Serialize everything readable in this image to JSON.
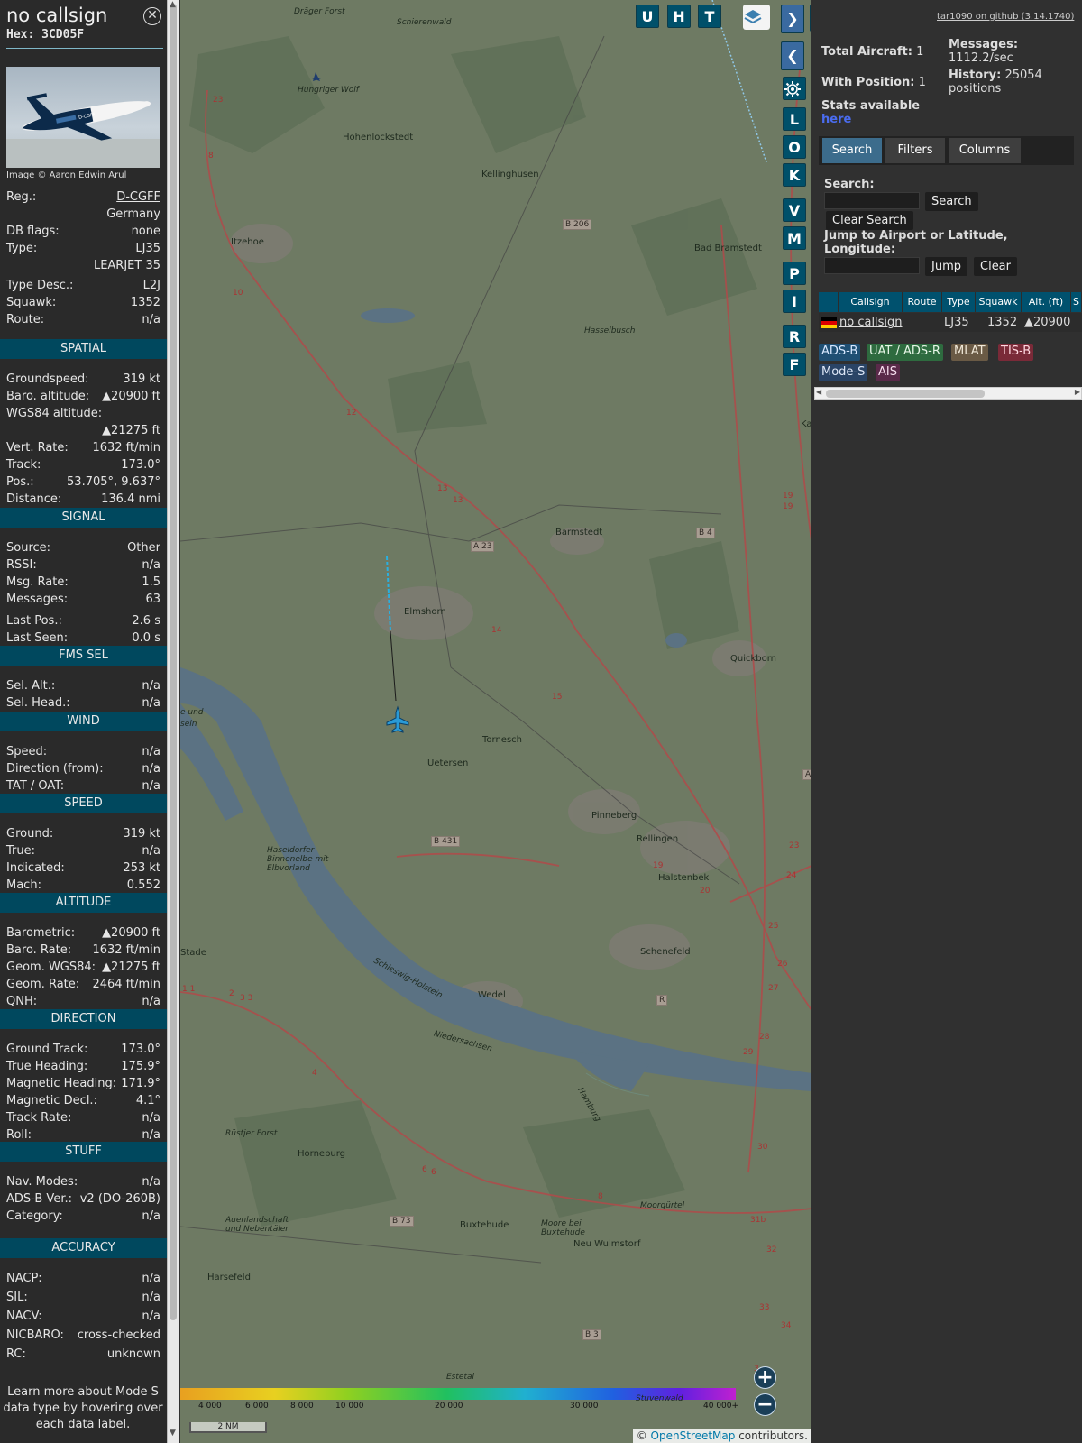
{
  "aircraft": {
    "callsign": "no callsign",
    "hex_label": "Hex:",
    "hex": "3CD05F",
    "image_credit": "Image © Aaron Edwin Arul",
    "photo_livery": "D-CGFF",
    "reg_label": "Reg.:",
    "reg": "D-CGFF",
    "country": "Germany",
    "db_flags_label": "DB flags:",
    "db_flags": "none",
    "type_label": "Type:",
    "type": "LJ35",
    "type_full": "LEARJET 35",
    "type_desc_label": "Type Desc.:",
    "type_desc": "L2J",
    "squawk_label": "Squawk:",
    "squawk": "1352",
    "route_label": "Route:",
    "route": "n/a"
  },
  "sections": [
    {
      "title": "SPATIAL",
      "rows": [
        {
          "k": "Groundspeed:",
          "v": "319 kt"
        },
        {
          "k": "Baro. altitude:",
          "v": "▲20900 ft"
        },
        {
          "k": "WGS84 altitude:",
          "v": ""
        },
        {
          "k": "",
          "v": "▲21275 ft"
        },
        {
          "k": "Vert. Rate:",
          "v": "1632 ft/min"
        },
        {
          "k": "Track:",
          "v": "173.0°"
        },
        {
          "k": "Pos.:",
          "v": "53.705°, 9.637°"
        },
        {
          "k": "Distance:",
          "v": "136.4 nmi"
        }
      ]
    },
    {
      "title": "SIGNAL",
      "rows": [
        {
          "k": "Source:",
          "v": "Other"
        },
        {
          "k": "RSSI:",
          "v": "n/a"
        },
        {
          "k": "Msg. Rate:",
          "v": "1.5"
        },
        {
          "k": "Messages:",
          "v": "63"
        },
        {
          "k": "Last Pos.:",
          "v": "2.6 s"
        },
        {
          "k": "Last Seen:",
          "v": "0.0 s"
        }
      ]
    },
    {
      "title": "FMS SEL",
      "rows": [
        {
          "k": "Sel. Alt.:",
          "v": "n/a"
        },
        {
          "k": "Sel. Head.:",
          "v": "n/a"
        }
      ]
    },
    {
      "title": "WIND",
      "rows": [
        {
          "k": "Speed:",
          "v": "n/a"
        },
        {
          "k": "Direction (from):",
          "v": "n/a"
        },
        {
          "k": "TAT / OAT:",
          "v": "n/a"
        }
      ]
    },
    {
      "title": "SPEED",
      "rows": [
        {
          "k": "Ground:",
          "v": "319 kt"
        },
        {
          "k": "True:",
          "v": "n/a"
        },
        {
          "k": "Indicated:",
          "v": "253 kt"
        },
        {
          "k": "Mach:",
          "v": "0.552"
        }
      ]
    },
    {
      "title": "ALTITUDE",
      "rows": [
        {
          "k": "Barometric:",
          "v": "▲20900 ft"
        },
        {
          "k": "Baro. Rate:",
          "v": "1632 ft/min"
        },
        {
          "k": "Geom. WGS84:",
          "v": "▲21275 ft"
        },
        {
          "k": "Geom. Rate:",
          "v": "2464 ft/min"
        },
        {
          "k": "QNH:",
          "v": "n/a"
        }
      ]
    },
    {
      "title": "DIRECTION",
      "rows": [
        {
          "k": "Ground Track:",
          "v": "173.0°"
        },
        {
          "k": "True Heading:",
          "v": "175.9°"
        },
        {
          "k": "Magnetic Heading:",
          "v": "171.9°"
        },
        {
          "k": "Magnetic Decl.:",
          "v": "4.1°"
        },
        {
          "k": "Track Rate:",
          "v": "n/a"
        },
        {
          "k": "Roll:",
          "v": "n/a"
        }
      ]
    },
    {
      "title": "STUFF",
      "rows": [
        {
          "k": "Nav. Modes:",
          "v": "n/a"
        },
        {
          "k": "ADS-B Ver.:",
          "v": "v2 (DO-260B)"
        },
        {
          "k": "Category:",
          "v": "n/a"
        }
      ]
    },
    {
      "title": "ACCURACY",
      "rows": [
        {
          "k": "NACP:",
          "v": "n/a"
        },
        {
          "k": "SIL:",
          "v": "n/a"
        },
        {
          "k": "NACV:",
          "v": "n/a"
        },
        {
          "k": "NICBARO:",
          "v": "cross-checked"
        },
        {
          "k": "RC:",
          "v": "unknown"
        }
      ]
    }
  ],
  "footer_note": "Learn more about Mode S data type by hovering over each data label.",
  "map": {
    "top_buttons": [
      "U",
      "H",
      "T"
    ],
    "layers_icon": "layers-icon",
    "side_buttons": [
      "L",
      "O",
      "K",
      "V",
      "M",
      "P",
      "I",
      "R",
      "F"
    ],
    "settings_icon": "gear-icon",
    "places": [
      "Dräger Forst",
      "Schierenwald",
      "Hungriger Wolf",
      "Hohenlockstedt",
      "Kellinghusen",
      "Itzehoe",
      "Bad Bramstedt",
      "Hasselbusch",
      "Barmstedt",
      "Elmshorn",
      "Quickborn",
      "Tornesch",
      "Uetersen",
      "Pinneberg",
      "Rellingen",
      "Halstenbek",
      "Schenefeld",
      "Wedel",
      "Stade",
      "Horneburg",
      "Buxtehude",
      "Neu Wulmstorf",
      "Harsefeld",
      "Haseldorfer Binnenelbe mit Elbvorland",
      "Schleswig-Holstein",
      "Niedersachsen",
      "Hamburg",
      "Moorgürtel",
      "Rüstjer Forst",
      "Auenlandschaft und Nebentäler",
      "Moore bei Buxtehude",
      "Estetal",
      "Stuvenwald",
      "Ka",
      "e und",
      "seln"
    ],
    "roads": [
      "B 206",
      "A 23",
      "B 4",
      "B 431",
      "B 73",
      "B 3",
      "R",
      "A"
    ],
    "road_numbers": [
      "23",
      "8",
      "10",
      "12",
      "13",
      "13",
      "14",
      "15",
      "19",
      "20",
      "19",
      "19",
      "23",
      "24",
      "25",
      "26",
      "27",
      "28",
      "29",
      "30",
      "31b",
      "32",
      "33",
      "34",
      "3",
      "6",
      "6",
      "8",
      "4",
      "1 1",
      "2",
      "3 3"
    ],
    "altitude_legend": [
      "4 000",
      "6 000",
      "8 000",
      "10 000",
      "20 000",
      "30 000",
      "40 000+"
    ],
    "scale": "2 NM",
    "attribution_prefix": "©",
    "attribution_link": "OpenStreetMap",
    "attribution_suffix": "contributors.",
    "zoom_in": "+",
    "zoom_out": "−",
    "nav_next": "❯",
    "nav_prev": "❮",
    "toggle_panel": "◂▸"
  },
  "right": {
    "version_link": "tar1090 on github (3.14.1740)",
    "total_aircraft_label": "Total Aircraft:",
    "total_aircraft": "1",
    "with_position_label": "With Position:",
    "with_position": "1",
    "messages_label": "Messages:",
    "messages": "1112.2/sec",
    "history_label": "History:",
    "history": "25054 positions",
    "stats_label": "Stats available",
    "stats_link": "here",
    "tabs": [
      "Search",
      "Filters",
      "Columns"
    ],
    "search_label": "Search:",
    "search_button": "Search",
    "clear_search_button": "Clear Search",
    "jump_label": "Jump to Airport or Latitude, Longitude:",
    "jump_button": "Jump",
    "clear_button": "Clear",
    "columns": [
      "Callsign",
      "Route",
      "Type",
      "Squawk",
      "Alt. (ft)",
      "S"
    ],
    "table_rows": [
      {
        "callsign": "no callsign",
        "route": "",
        "type": "LJ35",
        "squawk": "1352",
        "alt": "▲20900"
      }
    ],
    "sources": [
      {
        "label": "ADS-B",
        "bg": "#1f4f73",
        "fg": "#d8e8ff"
      },
      {
        "label": "UAT / ADS-R",
        "bg": "#2e6b3f",
        "fg": "#e6f5e6"
      },
      {
        "label": "MLAT",
        "bg": "#6a5a45",
        "fg": "#f0e8d8"
      },
      {
        "label": "TIS-B",
        "bg": "#7a2a38",
        "fg": "#ffd8e0"
      },
      {
        "label": "Mode-S",
        "bg": "#2a4466",
        "fg": "#dfe8f8"
      },
      {
        "label": "AIS",
        "bg": "#5a2a4a",
        "fg": "#f8dff0"
      }
    ]
  }
}
